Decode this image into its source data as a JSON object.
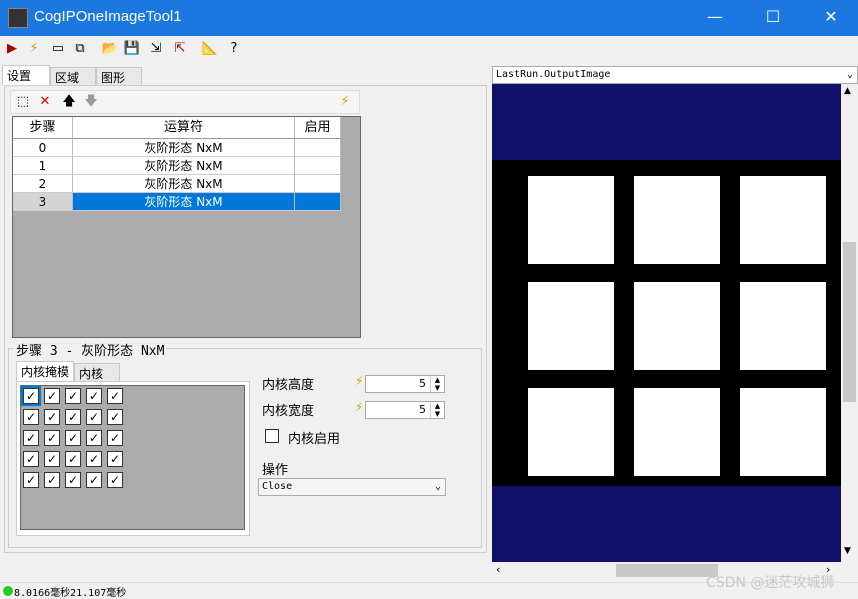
{
  "window": {
    "title": "CogIPOneImageTool1",
    "minimize": "—",
    "maximize": "☐",
    "close": "✕"
  },
  "toolbar": {
    "icons": [
      "run-icon",
      "lightning-icon",
      "display-icon",
      "copy-icon",
      "open-icon",
      "save-icon",
      "import-icon",
      "export-icon",
      "ruler-icon",
      "help-icon"
    ]
  },
  "tabs": [
    "设置",
    "区域",
    "图形"
  ],
  "grid": {
    "headers": [
      "步骤",
      "运算符",
      "启用"
    ],
    "rows": [
      {
        "step": "0",
        "op": "灰阶形态 NxM"
      },
      {
        "step": "1",
        "op": "灰阶形态 NxM"
      },
      {
        "step": "2",
        "op": "灰阶形态 NxM"
      },
      {
        "step": "3",
        "op": "灰阶形态 NxM"
      }
    ],
    "selected_row": 3
  },
  "group": {
    "title": "步骤 3 - 灰阶形态 NxM"
  },
  "subtabs": [
    "内核掩模",
    "内核"
  ],
  "kernel": {
    "rows": 5,
    "cols": 5
  },
  "params": {
    "height_label": "内核高度",
    "height_value": "5",
    "width_label": "内核宽度",
    "width_value": "5",
    "enable_label": "内核启用",
    "op_label": "操作",
    "op_value": "Close"
  },
  "image_panel": {
    "dropdown": "LastRun.OutputImage"
  },
  "statusbar": {
    "text": "8.0166毫秒21.107毫秒",
    "status_color": "#22cc22"
  },
  "watermark": "CSDN @迷茫攻城狮"
}
